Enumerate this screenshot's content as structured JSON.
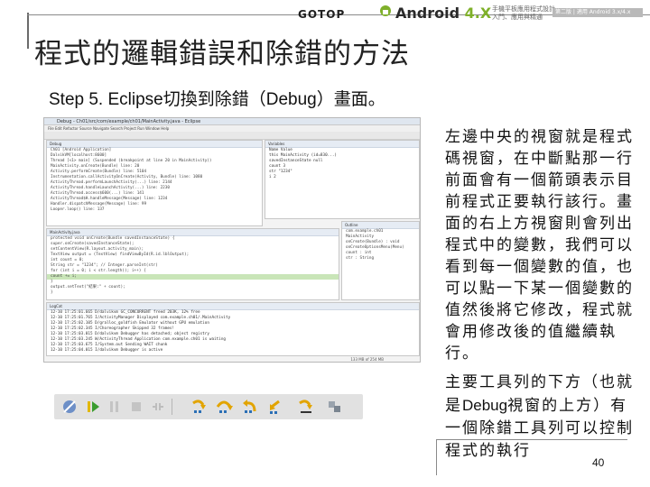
{
  "header": {
    "publisher": "GOTOP",
    "brand_main": "Android ",
    "brand_version": "4.X",
    "brand_sub_1": "手機平板應用程式設計",
    "brand_sub_2": "入門、應用與精通",
    "brand_badge": "第二版 | 適用 Android 3.x/4.x"
  },
  "title": "程式的邏輯錯誤和除錯的方法",
  "step": "Step 5. Eclipse切換到除錯（Debug）畫面。",
  "screenshot": {
    "window_title": "Debug - Ch01/src/com/example/ch01/MainActivity.java - Eclipse",
    "menu": "File  Edit  Refactor  Source  Navigate  Search  Project  Run  Window  Help",
    "debug_tab": "Debug",
    "debug_lines": [
      "Ch01 [Android Application]",
      "DalvikVM[localhost:8600]",
      "Thread [<1> main] (Suspended (breakpoint at line 20 in MainActivity))",
      "MainActivity.onCreate(Bundle) line: 20",
      "Activity.performCreate(Bundle) line: 5104",
      "Instrumentation.callActivityOnCreate(Activity, Bundle) line: 1080",
      "ActivityThread.performLaunchActivity(...) line: 2144",
      "ActivityThread.handleLaunchActivity(...) line: 2230",
      "ActivityThread.access$600(...) line: 141",
      "ActivityThread$H.handleMessage(Message) line: 1234",
      "Handler.dispatchMessage(Message) line: 99",
      "Looper.loop() line: 137"
    ],
    "vars_tab": "Variables",
    "vars_lines": [
      "Name                Value",
      "this                MainActivity (id=830...)",
      "savedInstanceState  null",
      "count               3",
      "str                 \"1234\"",
      "i                   2"
    ],
    "outline_tab": "Outline",
    "outline_lines": [
      "com.example.ch01",
      "MainActivity",
      "onCreate(Bundle) : void",
      "onCreateOptionsMenu(Menu)",
      "count : int",
      "str : String"
    ],
    "code_tab": "MainActivity.java",
    "code_lines": [
      "protected void onCreate(Bundle savedInstanceState) {",
      "    super.onCreate(savedInstanceState);",
      "    setContentView(R.layout.activity_main);",
      "    TextView output = (TextView) findViewById(R.id.lblOutput);",
      "    int count = 0;",
      "    String str = \"1234\"; // Integer.parseInt(str)",
      "    for (int i = 0; i < str.length(); i++) {",
      "        count += i;",
      "    }",
      "    output.setText(\"結果:\" + count);",
      "}"
    ],
    "console_tab": "LogCat",
    "console_lines": [
      "12-10 17:25:01.665  D/dalvikvm  GC_CONCURRENT freed 203K, 12% free",
      "12-10 17:25:01.765  I/ActivityManager  Displayed com.example.ch01/.MainActivity",
      "12-10 17:25:02.105  D/gralloc_goldfish  Emulator without GPU emulation",
      "12-10 17:25:02.345  I/Choreographer  Skipped 32 frames!",
      "12-10 17:25:03.015  D/dalvikvm  Debugger has detached; object registry",
      "12-10 17:25:03.245  W/ActivityThread  Application com.example.ch01 is waiting",
      "12-10 17:25:03.675  I/System.out  Sending WAIT chunk",
      "12-10 17:25:04.015  I/dalvikvm  Debugger is active"
    ],
    "status": "133 MB of 254 MB"
  },
  "toolbar": {
    "buttons": [
      "skip-breakpoints",
      "resume",
      "suspend",
      "terminate",
      "disconnect",
      "step-into",
      "step-over",
      "step-return",
      "drop-to-frame",
      "use-step-filters",
      "more"
    ]
  },
  "description": "左邊中央的視窗就是程式碼視窗，在中斷點那一行前面會有一個箭頭表示目前程式正要執行該行。畫面的右上方視窗則會列出程式中的變數，我們可以看到每一個變數的值，也可以點一下某一個變數的值然後將它修改，程式就會用修改後的值繼續執行。",
  "description2_a": "主要工具列的下方（也就是",
  "description2_b": "Debug",
  "description2_c": "視窗的上方）有一個除錯工具列可以控制程式的執行",
  "page_number": "40",
  "colors": {
    "accent_green": "#7fb02a",
    "highlight_line": "#c9e5b8",
    "toolbar_bg": "#e1e1e1"
  }
}
